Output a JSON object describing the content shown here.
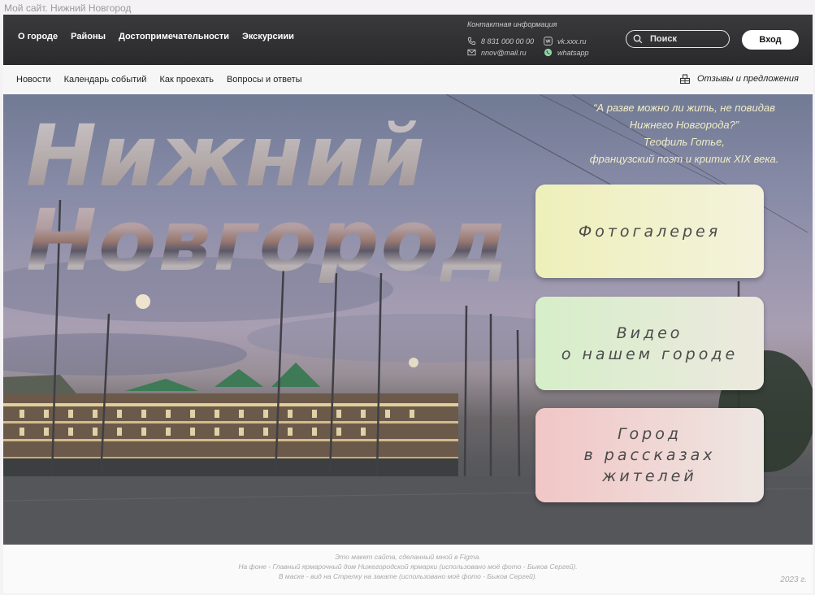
{
  "window": {
    "title": "Мой сайт. Нижний Новгород"
  },
  "header": {
    "nav": [
      "О городе",
      "Районы",
      "Достопримечательности",
      "Экскурсиии"
    ],
    "contact_title": "Контактная информация",
    "phone": "8 831 000 00 00",
    "email": "nnov@mail.ru",
    "vk": "vk.xxx.ru",
    "whatsapp": "whatsapp",
    "search_placeholder": "Поиск",
    "login_label": "Вход"
  },
  "subnav": {
    "items": [
      "Новости",
      "Календарь событий",
      "Как проехать",
      "Вопросы и ответы"
    ],
    "feedback": "Отзывы и предложения"
  },
  "hero": {
    "title_line1": "Нижний",
    "title_line2": "Новгород",
    "quote": [
      "“А разве можно ли жить, не повидав",
      "Нижнего Новгорода?”",
      "Теофиль Готье,",
      "французский поэт и критик XIX века."
    ],
    "cards": [
      {
        "lines": [
          "Фотогалерея"
        ],
        "color": "#eef0ba"
      },
      {
        "lines": [
          "Видео",
          "о нашем городе"
        ],
        "color": "#d6eec9"
      },
      {
        "lines": [
          "Город",
          "в рассказах",
          "жителей"
        ],
        "color": "#f1c6c6"
      }
    ]
  },
  "footer": {
    "credits": [
      "Это макет сайта, сделанный мной в Figma.",
      "На фоне - Главный ярмарочный дом Нижегородской ярмарки (использовано моё фото - Быков Сергей).",
      "В маске - вид на Стрелку на закате (использовано моё фото - Быков Сергей)."
    ],
    "year": "2023 г."
  },
  "colors": {
    "header_bg": "#2f2f31",
    "quote": "#f0eec6",
    "card_yellow": "#eef0ba",
    "card_green": "#d6eec9",
    "card_pink": "#f1c6c6"
  },
  "icons": [
    "phone-icon",
    "mail-icon",
    "vk-icon",
    "whatsapp-icon",
    "search-icon",
    "feedback-icon"
  ]
}
